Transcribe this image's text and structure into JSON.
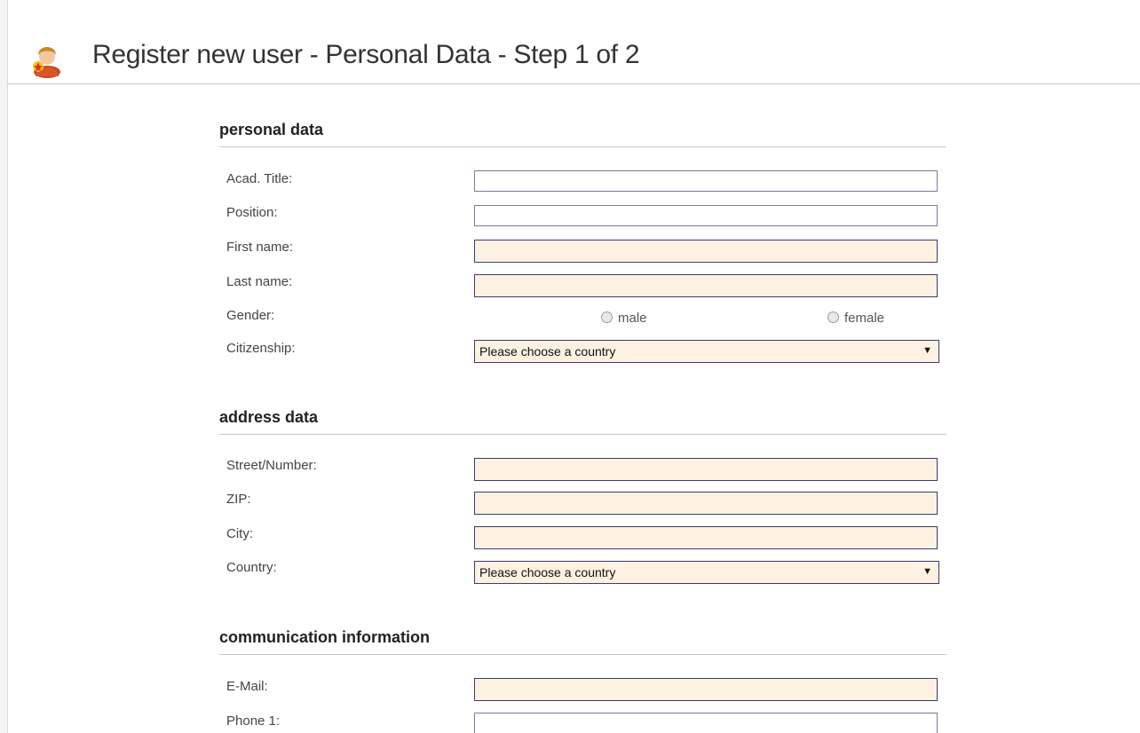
{
  "header": {
    "title": "Register new user - Personal Data - Step 1 of 2",
    "icon": "user-registration-icon"
  },
  "colors": {
    "required_field_bg": "#fdf1e2",
    "field_border": "#3c3c6e",
    "optional_field_border": "#7a7aa8"
  },
  "sections": {
    "personal": {
      "title": "personal data",
      "acad_title_label": "Acad. Title:",
      "acad_title_value": "",
      "position_label": "Position:",
      "position_value": "",
      "first_name_label": "First name:",
      "first_name_value": "",
      "last_name_label": "Last name:",
      "last_name_value": "",
      "gender_label": "Gender:",
      "gender_options": [
        "male",
        "female"
      ],
      "citizenship_label": "Citizenship:",
      "citizenship_value": "Please choose a country"
    },
    "address": {
      "title": "address data",
      "street_label": "Street/Number:",
      "street_value": "",
      "zip_label": "ZIP:",
      "zip_value": "",
      "city_label": "City:",
      "city_value": "",
      "country_label": "Country:",
      "country_value": "Please choose a country"
    },
    "communication": {
      "title": "communication information",
      "email_label": "E-Mail:",
      "email_value": "",
      "phone1_label": "Phone 1:",
      "phone1_value": ""
    }
  }
}
